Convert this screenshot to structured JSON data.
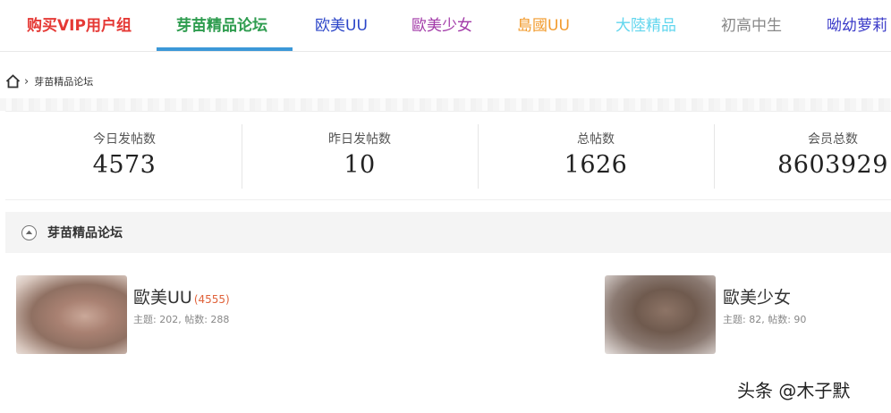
{
  "nav": {
    "tabs": [
      {
        "label": "购买VIP用户组",
        "color": "#e53935"
      },
      {
        "label": "芽苗精品论坛",
        "color": "#2e9c4f"
      },
      {
        "label": "欧美UU",
        "color": "#2b45c8"
      },
      {
        "label": "歐美少女",
        "color": "#a23aa8"
      },
      {
        "label": "島國UU",
        "color": "#f29b2e"
      },
      {
        "label": "大陸精品",
        "color": "#62d6ee"
      },
      {
        "label": "初高中生",
        "color": "#888888"
      },
      {
        "label": "呦幼萝莉",
        "color": "#3a3ac8"
      }
    ],
    "active_index": 1,
    "active_underline_color": "#3b98d8"
  },
  "breadcrumb": {
    "home_icon": "home-icon",
    "separator": "›",
    "current": "芽苗精品论坛"
  },
  "stats": [
    {
      "label": "今日发帖数",
      "value": "4573"
    },
    {
      "label": "昨日发帖数",
      "value": "10"
    },
    {
      "label": "总帖数",
      "value": "1626"
    },
    {
      "label": "会员总数",
      "value": "8603929"
    }
  ],
  "section": {
    "title": "芽苗精品论坛",
    "toggle_icon": "collapse-icon"
  },
  "forums": [
    {
      "name": "歐美UU",
      "count": "(4555)",
      "meta": "主题: 202, 帖数: 288"
    },
    {
      "name": "歐美少女",
      "count": "",
      "meta": "主题: 82, 帖数: 90"
    }
  ],
  "watermark": "头条 @木子默"
}
